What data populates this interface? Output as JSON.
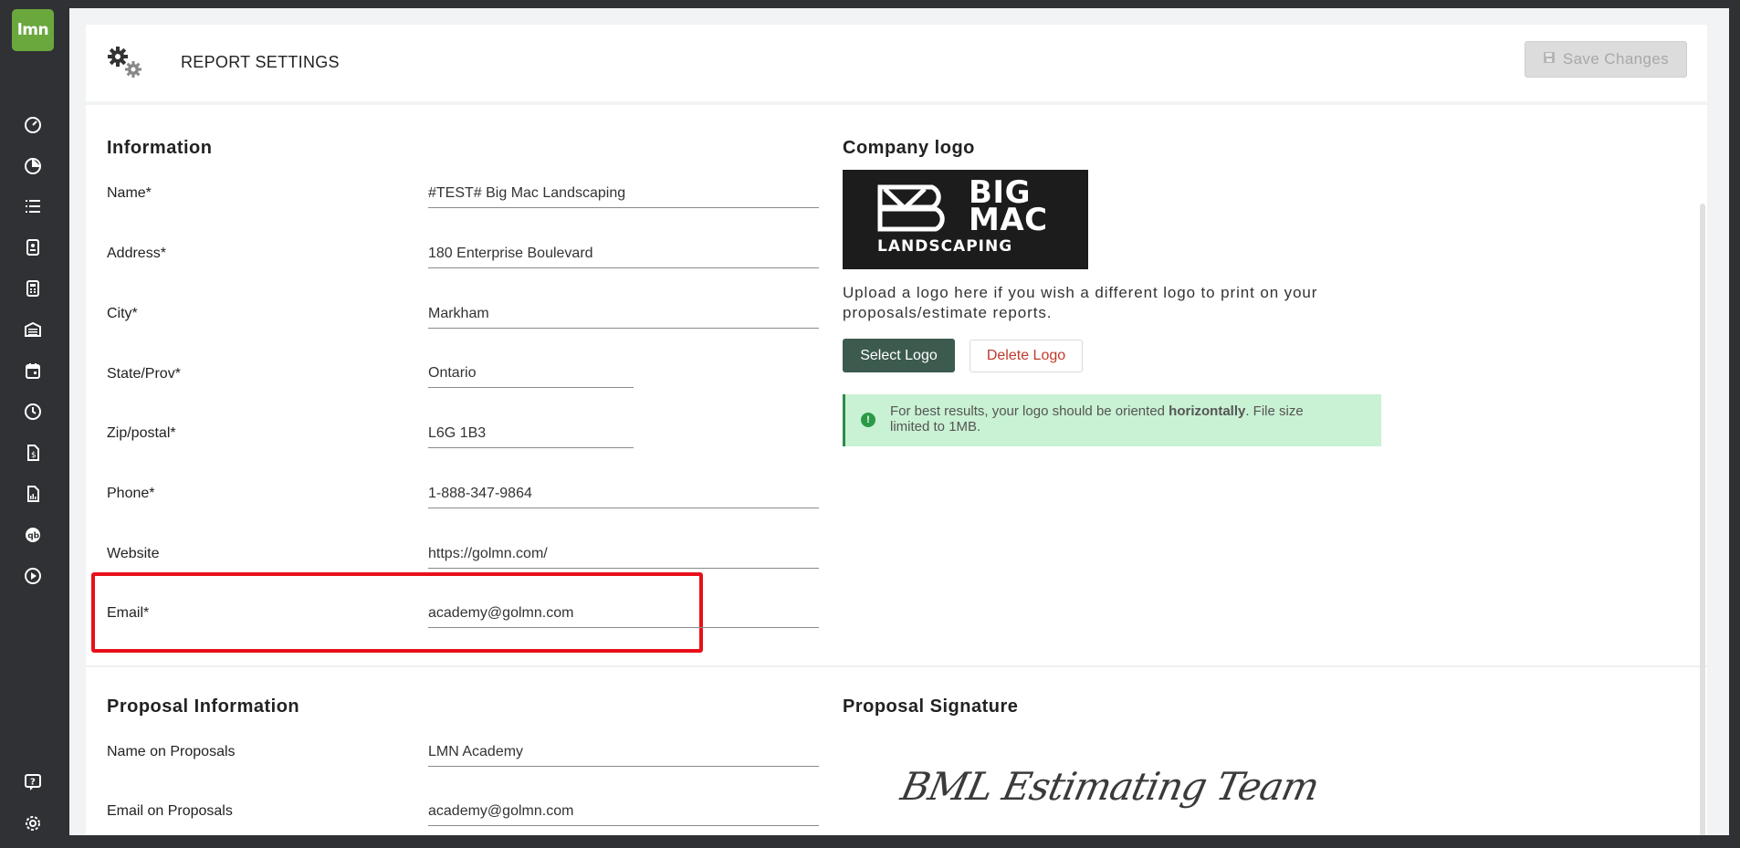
{
  "app": {
    "logo_text": "lmn"
  },
  "sidebar": {
    "icons": [
      "dashboard-icon",
      "pie-chart-icon",
      "list-icon",
      "timesheet-icon",
      "calculator-icon",
      "warehouse-icon",
      "calendar-icon",
      "clock-icon",
      "invoice-icon",
      "report-icon",
      "quickbooks-icon",
      "play-icon"
    ],
    "bottom_icons": [
      "help-icon",
      "settings-icon"
    ]
  },
  "header": {
    "title": "REPORT SETTINGS",
    "save_label": "Save Changes"
  },
  "information": {
    "title": "Information",
    "fields": [
      {
        "label": "Name*",
        "value": "#TEST# Big Mac Landscaping"
      },
      {
        "label": "Address*",
        "value": "180 Enterprise Boulevard"
      },
      {
        "label": "City*",
        "value": "Markham"
      },
      {
        "label": "State/Prov*",
        "value": "Ontario"
      },
      {
        "label": "Zip/postal*",
        "value": "L6G 1B3"
      },
      {
        "label": "Phone*",
        "value": "1-888-347-9864"
      },
      {
        "label": "Website",
        "value": "https://golmn.com/"
      },
      {
        "label": "Email*",
        "value": "academy@golmn.com"
      }
    ]
  },
  "company_logo": {
    "title": "Company logo",
    "logo_line1": "BIG",
    "logo_line2": "MAC",
    "logo_line3": "LANDSCAPING",
    "upload_note": "Upload a logo here if you wish a different logo to print on your proposals/estimate reports.",
    "select_label": "Select Logo",
    "delete_label": "Delete Logo",
    "alert_prefix": "For best results, your logo should be oriented ",
    "alert_bold": "horizontally",
    "alert_suffix": ". File size limited to 1MB."
  },
  "proposal_information": {
    "title": "Proposal Information",
    "fields": [
      {
        "label": "Name on Proposals",
        "value": "LMN Academy"
      },
      {
        "label": "Email on Proposals",
        "value": "academy@golmn.com"
      }
    ]
  },
  "proposal_signature": {
    "title": "Proposal Signature",
    "signature_text": "BML Estimating Team"
  },
  "colors": {
    "brand_green": "#6aa83e",
    "select_button": "#3c5a4e",
    "delete_text": "#c0392b",
    "highlight": "#e8101a",
    "alert_bg": "#c9f1d3"
  }
}
